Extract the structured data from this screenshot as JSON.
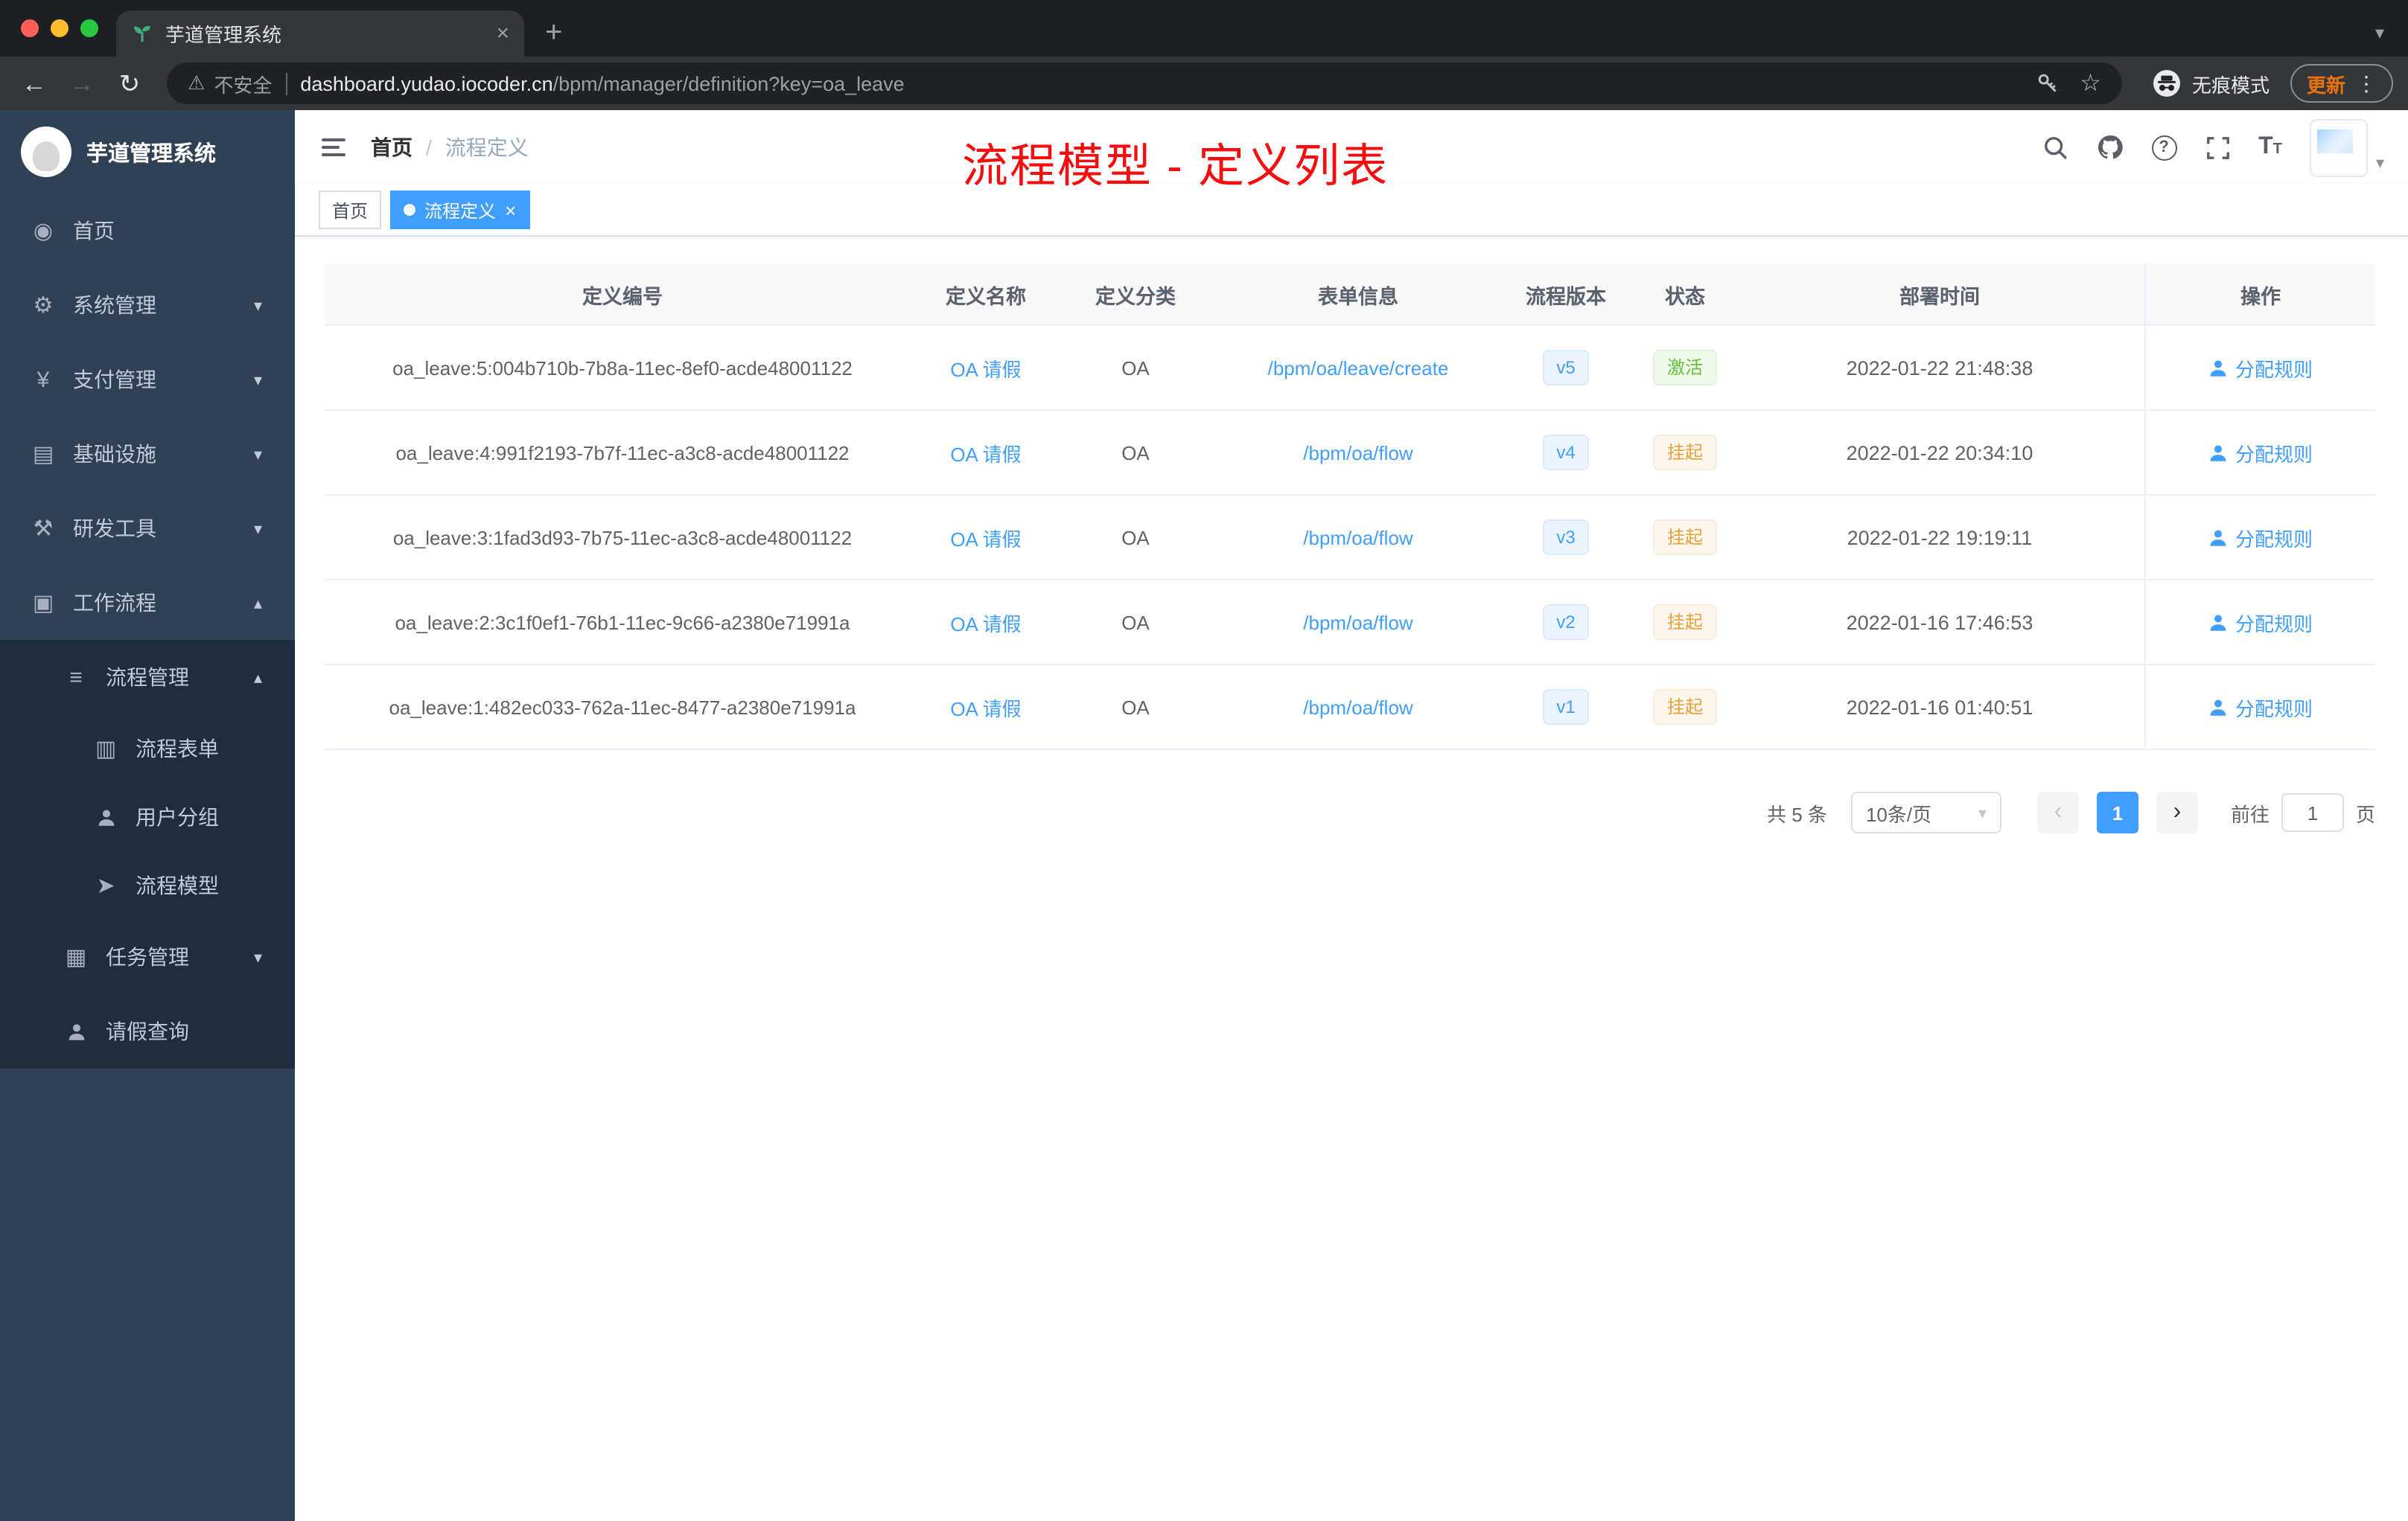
{
  "browser": {
    "tab_title": "芋道管理系统",
    "security_label": "不安全",
    "url_domain": "dashboard.yudao.iocoder.cn",
    "url_path": "/bpm/manager/definition?key=oa_leave",
    "incognito_label": "无痕模式",
    "update_label": "更新"
  },
  "icons": {
    "back": "←",
    "forward": "→",
    "reload": "↻",
    "warning": "⚠",
    "star": "☆",
    "dots": "⋮",
    "plus": "+",
    "close": "×",
    "caret_down": "▾",
    "caret_up": "▴",
    "prev": "‹",
    "next": "›",
    "question": "?",
    "font": "T",
    "dashboard": "◉",
    "gear": "⚙",
    "yen": "¥",
    "infra": "▤",
    "tools": "⚒",
    "workflow": "▣",
    "list": "≡",
    "form": "▥",
    "send": "➤",
    "task": "▦"
  },
  "sidebar": {
    "brand": "芋道管理系统",
    "items": [
      {
        "label": "首页",
        "level": 0,
        "icon": "dashboard",
        "chevron": null,
        "sub": false
      },
      {
        "label": "系统管理",
        "level": 0,
        "icon": "gear",
        "chevron": "down",
        "sub": false
      },
      {
        "label": "支付管理",
        "level": 0,
        "icon": "yen",
        "chevron": "down",
        "sub": false
      },
      {
        "label": "基础设施",
        "level": 0,
        "icon": "infra",
        "chevron": "down",
        "sub": false
      },
      {
        "label": "研发工具",
        "level": 0,
        "icon": "tools",
        "chevron": "down",
        "sub": false
      },
      {
        "label": "工作流程",
        "level": 0,
        "icon": "workflow",
        "chevron": "up",
        "sub": false
      },
      {
        "label": "流程管理",
        "level": 1,
        "icon": "list",
        "chevron": "up",
        "sub": true
      },
      {
        "label": "流程表单",
        "level": 2,
        "icon": "form",
        "chevron": null,
        "sub": true
      },
      {
        "label": "用户分组",
        "level": 2,
        "icon": "usergroup",
        "chevron": null,
        "sub": true
      },
      {
        "label": "流程模型",
        "level": 2,
        "icon": "send",
        "chevron": null,
        "sub": true
      },
      {
        "label": "任务管理",
        "level": 1,
        "icon": "task",
        "chevron": "down",
        "sub": true
      },
      {
        "label": "请假查询",
        "level": 1,
        "icon": "user",
        "chevron": null,
        "sub": true
      }
    ]
  },
  "header": {
    "breadcrumb_home": "首页",
    "breadcrumb_sep": "/",
    "breadcrumb_current": "流程定义",
    "annotation": "流程模型 - 定义列表"
  },
  "tags": [
    {
      "label": "首页",
      "active": false,
      "closable": false
    },
    {
      "label": "流程定义",
      "active": true,
      "closable": true
    }
  ],
  "table": {
    "columns": [
      "定义编号",
      "定义名称",
      "定义分类",
      "表单信息",
      "流程版本",
      "状态",
      "部署时间",
      "操作"
    ],
    "rows": [
      {
        "id": "oa_leave:5:004b710b-7b8a-11ec-8ef0-acde48001122",
        "name": "OA 请假",
        "category": "OA",
        "form": "/bpm/oa/leave/create",
        "version": "v5",
        "status": "激活",
        "status_type": "success",
        "deployed_at": "2022-01-22 21:48:38",
        "action": "分配规则"
      },
      {
        "id": "oa_leave:4:991f2193-7b7f-11ec-a3c8-acde48001122",
        "name": "OA 请假",
        "category": "OA",
        "form": "/bpm/oa/flow",
        "version": "v4",
        "status": "挂起",
        "status_type": "warning",
        "deployed_at": "2022-01-22 20:34:10",
        "action": "分配规则"
      },
      {
        "id": "oa_leave:3:1fad3d93-7b75-11ec-a3c8-acde48001122",
        "name": "OA 请假",
        "category": "OA",
        "form": "/bpm/oa/flow",
        "version": "v3",
        "status": "挂起",
        "status_type": "warning",
        "deployed_at": "2022-01-22 19:19:11",
        "action": "分配规则"
      },
      {
        "id": "oa_leave:2:3c1f0ef1-76b1-11ec-9c66-a2380e71991a",
        "name": "OA 请假",
        "category": "OA",
        "form": "/bpm/oa/flow",
        "version": "v2",
        "status": "挂起",
        "status_type": "warning",
        "deployed_at": "2022-01-16 17:46:53",
        "action": "分配规则"
      },
      {
        "id": "oa_leave:1:482ec033-762a-11ec-8477-a2380e71991a",
        "name": "OA 请假",
        "category": "OA",
        "form": "/bpm/oa/flow",
        "version": "v1",
        "status": "挂起",
        "status_type": "warning",
        "deployed_at": "2022-01-16 01:40:51",
        "action": "分配规则"
      }
    ]
  },
  "pagination": {
    "total": "共 5 条",
    "page_size": "10条/页",
    "current_page": "1",
    "goto_label": "前往",
    "goto_value": "1",
    "page_unit": "页"
  },
  "colors": {
    "accent": "#409eff",
    "sidebar_bg": "#304156",
    "submenu_bg": "#1f2d3d",
    "annotation_red": "#f70d0d",
    "tag_success": "#67c23a",
    "tag_warning": "#e6a23c"
  }
}
